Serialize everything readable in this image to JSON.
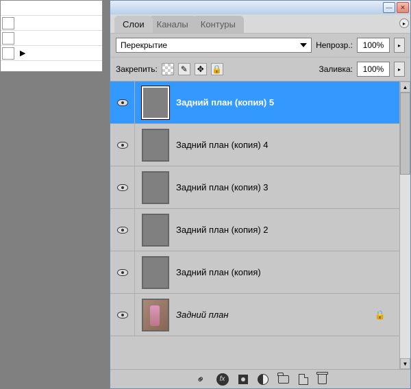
{
  "tabs": {
    "layers": "Слои",
    "channels": "Каналы",
    "paths": "Контуры"
  },
  "blend": {
    "mode": "Перекрытие",
    "opacity_label": "Непрозр.:",
    "opacity_value": "100%"
  },
  "lock": {
    "label": "Закрепить:",
    "fill_label": "Заливка:",
    "fill_value": "100%"
  },
  "layers_list": [
    {
      "name": "Задний план (копия) 5",
      "sel": true
    },
    {
      "name": "Задний план (копия) 4",
      "sel": false
    },
    {
      "name": "Задний план (копия) 3",
      "sel": false
    },
    {
      "name": "Задний план (копия) 2",
      "sel": false
    },
    {
      "name": "Задний план (копия)",
      "sel": false
    },
    {
      "name": "Задний план",
      "sel": false,
      "bg": true,
      "locked": true
    }
  ]
}
